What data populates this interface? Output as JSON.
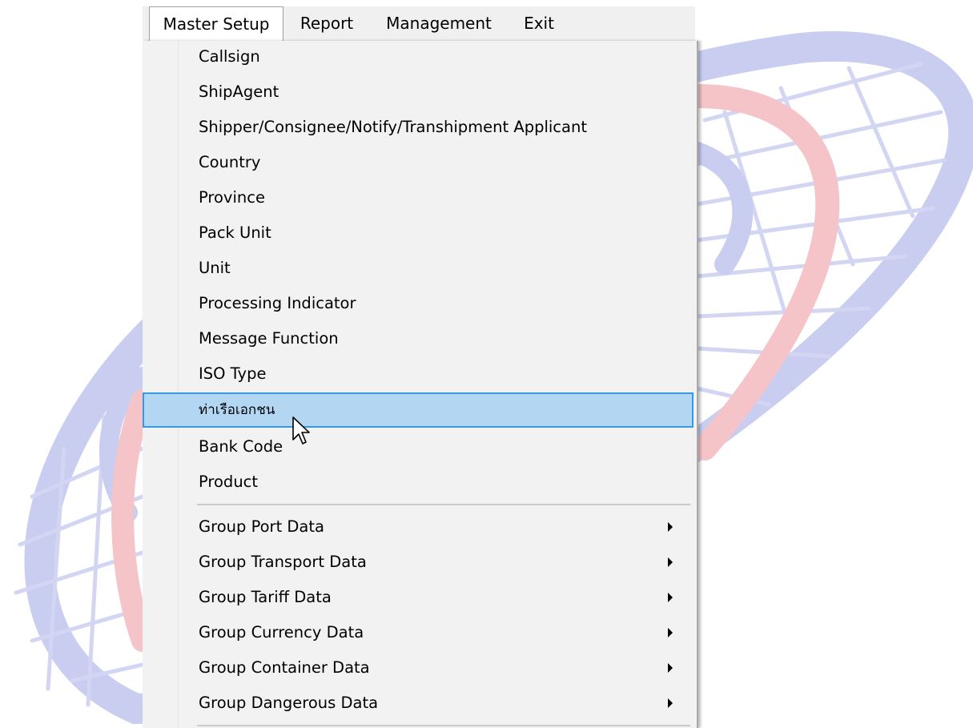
{
  "menubar": {
    "items": [
      {
        "label": "Master Setup",
        "active": true
      },
      {
        "label": "Report"
      },
      {
        "label": "Management"
      },
      {
        "label": "Exit"
      }
    ]
  },
  "dropdown": {
    "items": [
      {
        "label": "Callsign"
      },
      {
        "label": "ShipAgent"
      },
      {
        "label": "Shipper/Consignee/Notify/Transhipment Applicant"
      },
      {
        "label": "Country"
      },
      {
        "label": "Province"
      },
      {
        "label": "Pack Unit"
      },
      {
        "label": "Unit"
      },
      {
        "label": "Processing Indicator"
      },
      {
        "label": "Message Function"
      },
      {
        "label": "ISO Type"
      },
      {
        "label": "ท่าเรือเอกชน",
        "highlighted": true
      },
      {
        "label": "Bank Code"
      },
      {
        "label": "Product"
      }
    ],
    "groups": [
      {
        "label": "Group Port Data",
        "submenu": true
      },
      {
        "label": "Group Transport Data",
        "submenu": true
      },
      {
        "label": "Group Tariff Data",
        "submenu": true
      },
      {
        "label": "Group Currency Data",
        "submenu": true
      },
      {
        "label": "Group Container Data",
        "submenu": true
      },
      {
        "label": "Group Dangerous Data",
        "submenu": true
      }
    ]
  },
  "colors": {
    "menubar_bg": "#f0f0f0",
    "dropdown_bg": "#f2f2f2",
    "highlight_bg": "#b3d7f3",
    "highlight_border": "#3399e8",
    "logo_blue": "#c9cdf0",
    "logo_red": "#f5c4c9"
  },
  "icons": [
    "submenu-arrow-icon",
    "mouse-pointer-icon",
    "background-logo"
  ]
}
